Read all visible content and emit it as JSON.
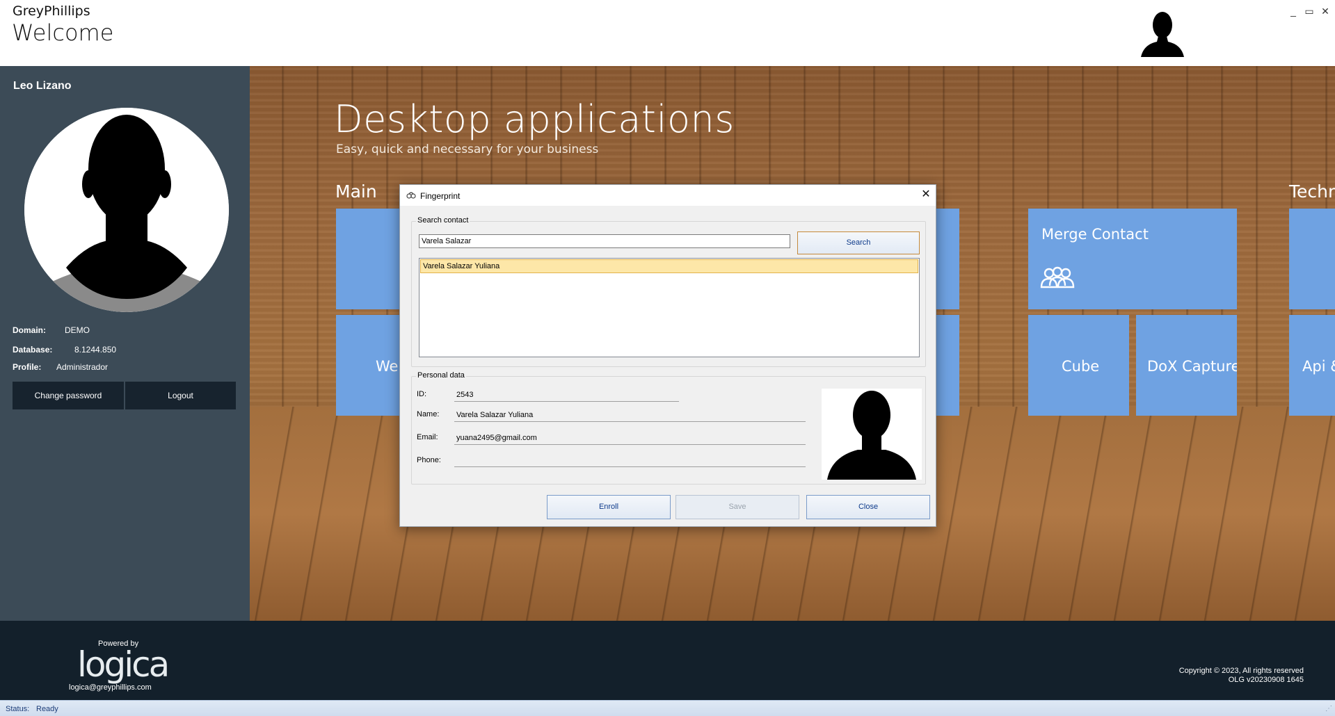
{
  "window": {
    "company": "GreyPhillips",
    "title": "Welcome",
    "controls": {
      "minimize": "_",
      "maximize": "▭",
      "close": "✕"
    }
  },
  "sidebar": {
    "user_name": "Leo Lizano",
    "info": [
      {
        "label": "Domain:",
        "value": "DEMO"
      },
      {
        "label": "Database:",
        "value": "8.1244.850"
      },
      {
        "label": "Profile:",
        "value": "Administrador"
      }
    ],
    "buttons": {
      "change_password": "Change password",
      "logout": "Logout"
    }
  },
  "main": {
    "title": "Desktop applications",
    "subtitle": "Easy, quick and necessary for your business",
    "groups": {
      "main": "Main",
      "technical": "Techn"
    },
    "tiles": {
      "main_2": "Wei",
      "merge_contact": "Merge Contact",
      "cube": "Cube",
      "dox_capture": "DoX Capture",
      "tech_2": "Api &"
    }
  },
  "dialog": {
    "title": "Fingerprint",
    "close_glyph": "✕",
    "search_group": "Search contact",
    "search_value": "Varela Salazar",
    "search_button": "Search",
    "results": [
      "Varela Salazar Yuliana"
    ],
    "personal_group": "Personal data",
    "fields": {
      "id": {
        "label": "ID:",
        "value": "2543"
      },
      "name": {
        "label": "Name:",
        "value": "Varela Salazar Yuliana"
      },
      "email": {
        "label": "Email:",
        "value": "yuana2495@gmail.com"
      },
      "phone": {
        "label": "Phone:",
        "value": ""
      }
    },
    "buttons": {
      "enroll": "Enroll",
      "save": "Save",
      "close": "Close"
    }
  },
  "footer": {
    "powered_by": "Powered by",
    "logo": "logica",
    "email": "logica@greyphillips.com",
    "copyright": "Copyright © 2023, All rights reserved",
    "version": "OLG v20230908 1645"
  },
  "status": {
    "label": "Status:",
    "value": "Ready",
    "grip": "⋰"
  },
  "colors": {
    "tile": "#6fa2e2",
    "sidebar": "#3c4b57",
    "footer": "#13202b",
    "selection": "#fde7a8"
  }
}
